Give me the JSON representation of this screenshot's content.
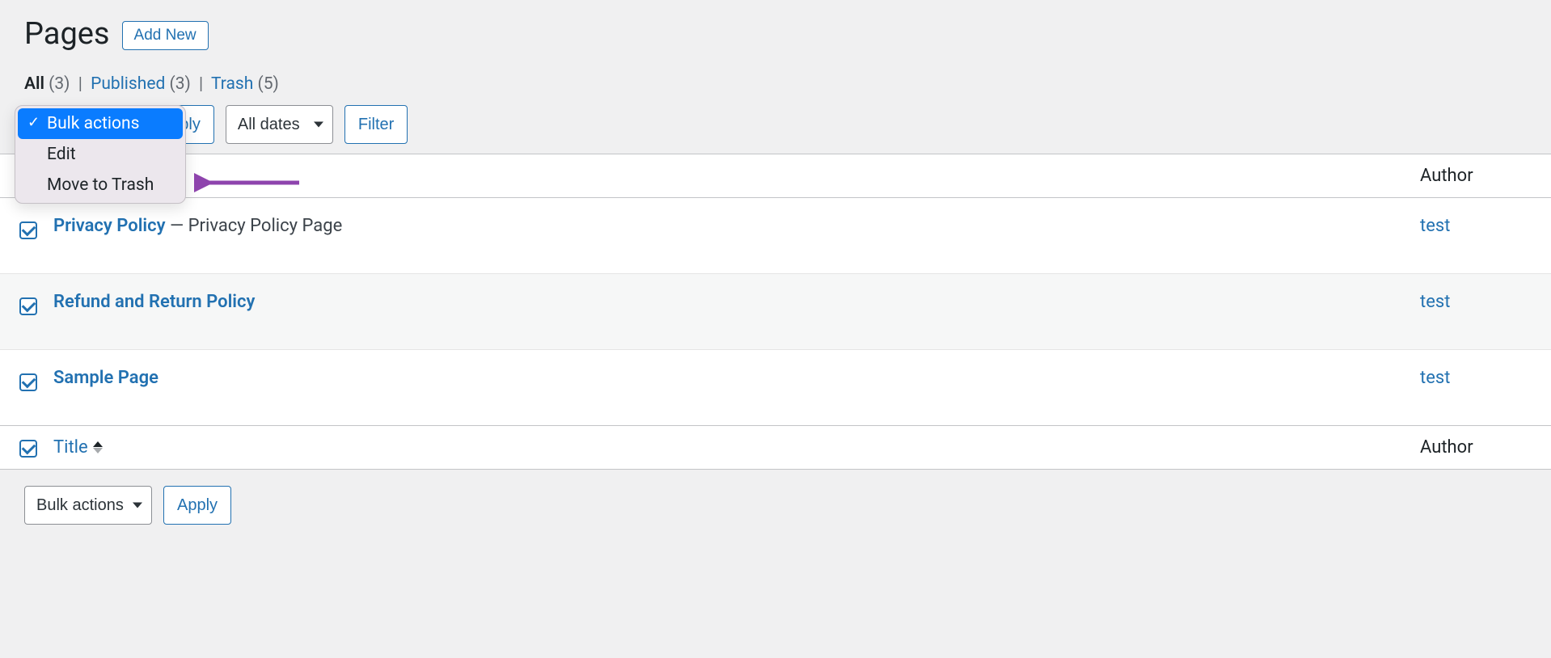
{
  "header": {
    "title": "Pages",
    "add_new": "Add New"
  },
  "filters": {
    "all_label": "All",
    "all_count": "(3)",
    "published_label": "Published",
    "published_count": "(3)",
    "trash_label": "Trash",
    "trash_count": "(5)"
  },
  "bulk_dropdown": {
    "bulk_actions": "Bulk actions",
    "edit": "Edit",
    "move_to_trash": "Move to Trash"
  },
  "toolbar": {
    "apply": "Apply",
    "dates": "All dates",
    "filter": "Filter"
  },
  "table": {
    "title_header": "Title",
    "author_header": "Author",
    "rows": [
      {
        "title": "Privacy Policy",
        "state": " — Privacy Policy Page",
        "author": "test"
      },
      {
        "title": "Refund and Return Policy",
        "state": "",
        "author": "test"
      },
      {
        "title": "Sample Page",
        "state": "",
        "author": "test"
      }
    ]
  },
  "bottom": {
    "bulk_actions": "Bulk actions",
    "apply": "Apply"
  }
}
